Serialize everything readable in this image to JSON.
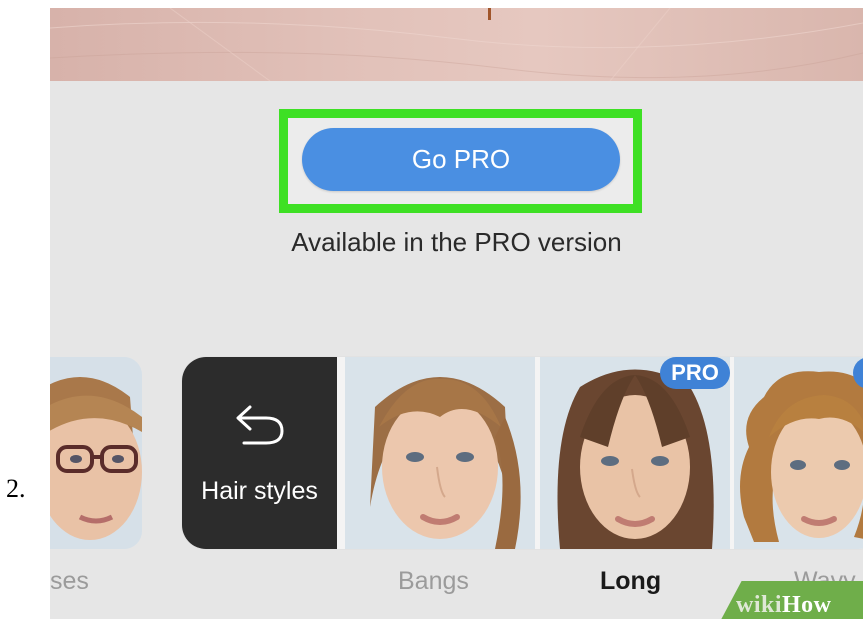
{
  "step": {
    "number": "2."
  },
  "pro_section": {
    "button_label": "Go PRO",
    "caption": "Available in the PRO version"
  },
  "hair_styles": {
    "back_label": "Hair styles",
    "back_icon": "undo-arrow-icon",
    "items": [
      {
        "label": "ses",
        "pro": false,
        "selected": false
      },
      {
        "label": "Bangs",
        "pro": false,
        "selected": false
      },
      {
        "label": "Long",
        "pro": true,
        "selected": true
      },
      {
        "label": "Wavy",
        "pro": true,
        "selected": false
      }
    ],
    "pro_badge": "PRO"
  },
  "watermark": {
    "part1": "wiki",
    "part2": "How"
  },
  "colors": {
    "go_pro_button": "#4a8fe2",
    "highlight": "#3ee024",
    "pro_badge": "#3f82d6",
    "back_tile": "#2c2c2c"
  }
}
